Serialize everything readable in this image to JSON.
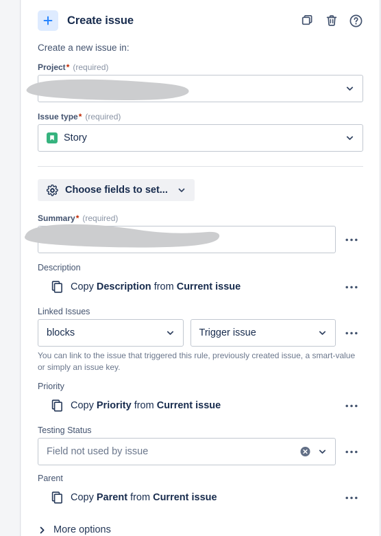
{
  "header": {
    "title": "Create issue",
    "add_icon": "plus-icon",
    "actions": [
      {
        "name": "duplicate-action-button",
        "icon": "duplicate-icon",
        "label": "Duplicate"
      },
      {
        "name": "delete-action-button",
        "icon": "trash-icon",
        "label": "Delete"
      },
      {
        "name": "help-button",
        "icon": "help-circle-icon",
        "label": "Help"
      }
    ]
  },
  "form": {
    "subtitle": "Create a new issue in:",
    "required_note": "(required)",
    "required_marker": "*",
    "project": {
      "label": "Project",
      "value": "",
      "redacted": true
    },
    "issue_type": {
      "label": "Issue type",
      "value": "Story",
      "icon": "story-icon",
      "icon_color": "#36b37e"
    },
    "choose_fields": {
      "label": "Choose fields to set...",
      "icon": "gear-icon",
      "chevron": "chevron-down-icon"
    },
    "summary": {
      "label": "Summary",
      "value": "",
      "redacted": true
    },
    "description": {
      "label": "Description",
      "copy_prefix": "Copy",
      "copy_field": "Description",
      "copy_middle": "from",
      "copy_source": "Current issue",
      "icon": "copy-icon"
    },
    "linked_issues": {
      "label": "Linked Issues",
      "link_type": "blocks",
      "target_issue": "Trigger issue",
      "help_text": "You can link to the issue that triggered this rule, previously created issue, a smart-value or simply an issue key."
    },
    "priority": {
      "label": "Priority",
      "copy_prefix": "Copy",
      "copy_field": "Priority",
      "copy_middle": "from",
      "copy_source": "Current issue",
      "icon": "copy-icon"
    },
    "testing_status": {
      "label": "Testing Status",
      "value": "Field not used by issue",
      "clear_icon": "clear-circle-icon",
      "chevron": "chevron-down-icon"
    },
    "parent": {
      "label": "Parent",
      "copy_prefix": "Copy",
      "copy_field": "Parent",
      "copy_middle": "from",
      "copy_source": "Current issue",
      "icon": "copy-icon"
    },
    "more_options": {
      "label": "More options",
      "icon": "chevron-right-icon"
    },
    "overflow_menu_label": "More actions"
  },
  "colors": {
    "accent_blue": "#2684ff",
    "badge_bg": "#deebff",
    "text_primary": "#172b4d",
    "text_secondary": "#42526e",
    "text_muted": "#6b778c",
    "border": "#c1c7d0",
    "panel_bg": "#ffffff",
    "page_bg": "#f4f5f7",
    "story_green": "#36b37e",
    "required_red": "#bf2600",
    "redaction_gray": "#cccdcf"
  }
}
